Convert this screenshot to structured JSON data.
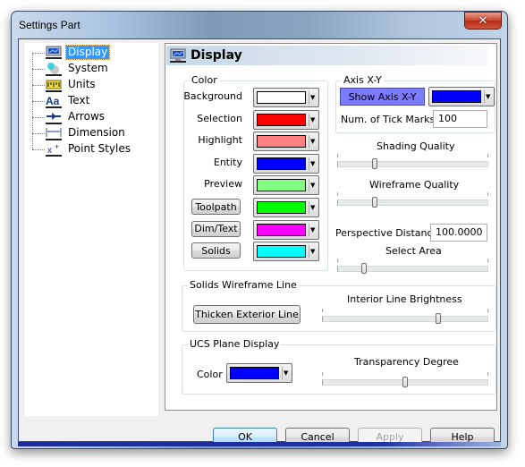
{
  "window": {
    "title": "Settings Part",
    "close_icon": "close-icon"
  },
  "tree": {
    "items": [
      {
        "label": "Display",
        "icon": "monitor-icon",
        "selected": true
      },
      {
        "label": "System",
        "icon": "system-icon",
        "selected": false
      },
      {
        "label": "Units",
        "icon": "ruler-icon",
        "selected": false
      },
      {
        "label": "Text",
        "icon": "text-aa-icon",
        "selected": false
      },
      {
        "label": "Arrows",
        "icon": "arrow-icon",
        "selected": false
      },
      {
        "label": "Dimension",
        "icon": "dimension-icon",
        "selected": false
      },
      {
        "label": "Point Styles",
        "icon": "point-styles-icon",
        "selected": false
      }
    ]
  },
  "panel": {
    "title": "Display",
    "icon": "monitor-icon",
    "color_group": {
      "label": "Color",
      "rows": [
        {
          "label": "Background",
          "type": "label",
          "color": "#ffffff"
        },
        {
          "label": "Selection",
          "type": "label",
          "color": "#ff0000"
        },
        {
          "label": "Highlight",
          "type": "label",
          "color": "#ff8080"
        },
        {
          "label": "Entity",
          "type": "label",
          "color": "#0000ff"
        },
        {
          "label": "Preview",
          "type": "label",
          "color": "#80ff80"
        },
        {
          "label": "Toolpath",
          "type": "button",
          "color": "#00ff00"
        },
        {
          "label": "Dim/Text",
          "type": "button",
          "color": "#ff00ff"
        },
        {
          "label": "Solids",
          "type": "button",
          "color": "#00ffff"
        }
      ]
    },
    "axis_group": {
      "label": "Axis X-Y",
      "show_axis_label": "Show Axis X-Y",
      "show_axis_active": true,
      "axis_color": "#0000ff",
      "tick_marks_label": "Num. of Tick Marks:",
      "tick_marks_value": "100"
    },
    "shading_quality": {
      "label": "Shading Quality",
      "value_percent": 25
    },
    "wireframe_quality": {
      "label": "Wireframe Quality",
      "value_percent": 25
    },
    "perspective": {
      "label": "Perspective Distance:",
      "value": "100.0000"
    },
    "select_area": {
      "label": "Select Area",
      "value_percent": 18
    },
    "solids_wireframe": {
      "label": "Solids Wireframe Line",
      "thicken_button": "Thicken Exterior Line",
      "brightness_label": "Interior Line Brightness",
      "brightness_percent": 70
    },
    "ucs_plane": {
      "label": "UCS Plane Display",
      "color_label": "Color",
      "color": "#0000ff",
      "transparency_label": "Transparency Degree",
      "transparency_percent": 50
    }
  },
  "buttons": {
    "ok": "OK",
    "cancel": "Cancel",
    "apply": "Apply",
    "help": "Help"
  }
}
